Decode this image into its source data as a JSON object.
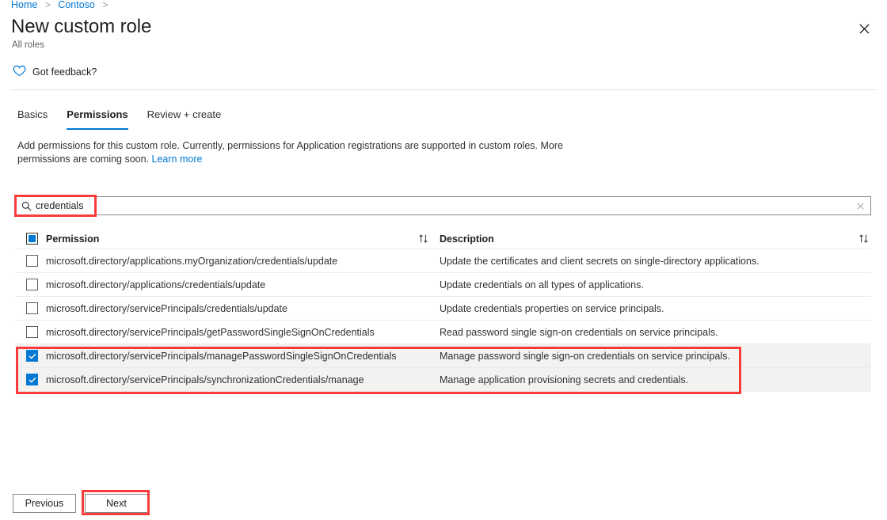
{
  "breadcrumb": {
    "items": [
      {
        "label": "Home"
      },
      {
        "label": "Contoso"
      }
    ],
    "separator": ">"
  },
  "header": {
    "title": "New custom role",
    "subtitle": "All roles",
    "close_label": "✕",
    "close_icon": "close-icon"
  },
  "feedback": {
    "label": "Got feedback?",
    "icon": "heart-icon"
  },
  "tabs": [
    {
      "label": "Basics",
      "active": false
    },
    {
      "label": "Permissions",
      "active": true
    },
    {
      "label": "Review + create",
      "active": false
    }
  ],
  "description": {
    "text": "Add permissions for this custom role. Currently, permissions for Application registrations are supported in custom roles. More permissions are coming soon. ",
    "link_label": "Learn more"
  },
  "search": {
    "value": "credentials",
    "placeholder": "Search permissions",
    "icon": "search-icon",
    "clear_label": "✕"
  },
  "table": {
    "columns": {
      "permission": "Permission",
      "description": "Description"
    },
    "header_checkbox_state": "indeterminate",
    "sort_icon": "sort-ascending-descending-icon",
    "rows": [
      {
        "checked": false,
        "permission": "microsoft.directory/applications.myOrganization/credentials/update",
        "description": "Update the certificates and client secrets on single-directory applications."
      },
      {
        "checked": false,
        "permission": "microsoft.directory/applications/credentials/update",
        "description": "Update credentials on all types of applications."
      },
      {
        "checked": false,
        "permission": "microsoft.directory/servicePrincipals/credentials/update",
        "description": "Update credentials properties on service principals."
      },
      {
        "checked": false,
        "permission": "microsoft.directory/servicePrincipals/getPasswordSingleSignOnCredentials",
        "description": "Read password single sign-on credentials on service principals."
      },
      {
        "checked": true,
        "permission": "microsoft.directory/servicePrincipals/managePasswordSingleSignOnCredentials",
        "description": "Manage password single sign-on credentials on service principals."
      },
      {
        "checked": true,
        "permission": "microsoft.directory/servicePrincipals/synchronizationCredentials/manage",
        "description": "Manage application provisioning secrets and credentials."
      }
    ]
  },
  "footer": {
    "previous_label": "Previous",
    "next_label": "Next"
  },
  "colors": {
    "accent": "#0078d4",
    "annotation": "#f93b3b",
    "selected_row": "#f3f2f1",
    "text": "#201f1e"
  }
}
